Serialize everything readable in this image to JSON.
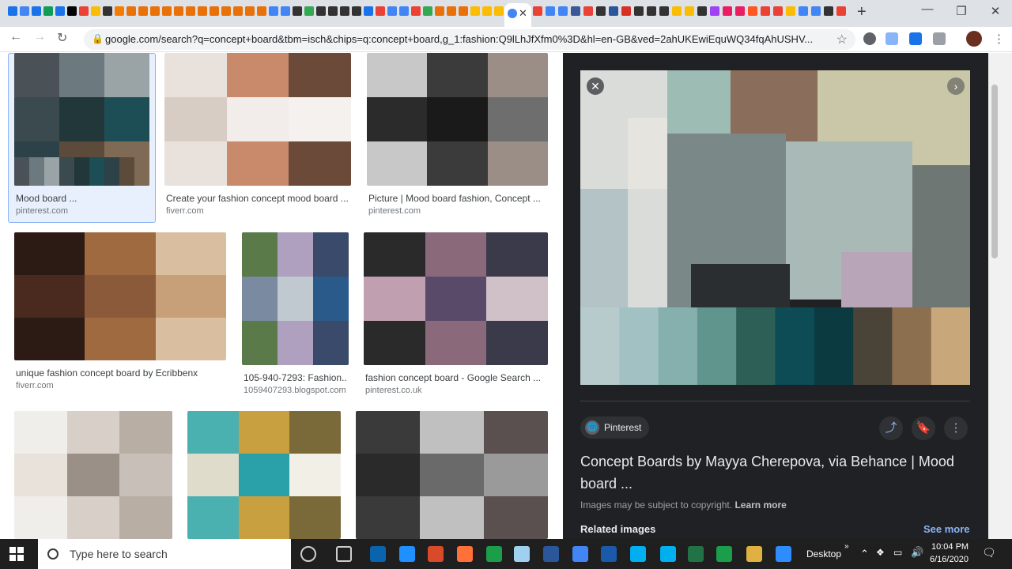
{
  "browser": {
    "tab_favicons": [
      "#1a73e8",
      "#4285f4",
      "#1a73e8",
      "#0f9d58",
      "#1a73e8",
      "#000000",
      "#ea4335",
      "#fbbc05",
      "#333333",
      "#f57c00",
      "#e8710a",
      "#e8710a",
      "#e8710a",
      "#e8710a",
      "#e8710a",
      "#e8710a",
      "#e8710a",
      "#e8710a",
      "#e8710a",
      "#e8710a",
      "#e8710a",
      "#e8710a",
      "#4285f4",
      "#4285f4",
      "#333333",
      "#34a853",
      "#333333",
      "#333333",
      "#333333",
      "#333333",
      "#1a73e8",
      "#ea4335",
      "#4285f4",
      "#4285f4",
      "#ea4335",
      "#34a853",
      "#e8710a",
      "#e8710a",
      "#e8710a",
      "#fbbc05",
      "#fbbc05",
      "#fbbc05"
    ],
    "tab_favicons_right": [
      "#ea4335",
      "#4285f4",
      "#4285f4",
      "#3b5998",
      "#ea4335",
      "#333333",
      "#2b579a",
      "#d93025",
      "#333333",
      "#333333",
      "#333333",
      "#fbbc05",
      "#fbbc05",
      "#333333",
      "#a142f4",
      "#e91e63",
      "#e91e63",
      "#ff5722",
      "#ea4335",
      "#ea4335",
      "#fbbc05",
      "#4285f4",
      "#4285f4",
      "#333333",
      "#ea4335"
    ],
    "active_tab_close": "✕",
    "new_tab": "+",
    "minimize": "—",
    "maximize": "❐",
    "close": "✕",
    "back": "←",
    "forward": "→",
    "reload": "↻",
    "url": "google.com/search?q=concept+board&tbm=isch&chips=q:concept+board,g_1:fashion:Q9lLhJfXfm0%3D&hl=en-GB&ved=2ahUKEwiEquWQ34fqAhUSHV...",
    "bookmark_star": "☆",
    "menu": "⋮"
  },
  "results": [
    {
      "title": "Mood board ...",
      "source": "pinterest.com",
      "selected": true,
      "palette": [
        "#4b5257",
        "#6c7a80",
        "#9aa4a6",
        "#3a4a4e",
        "#22373a",
        "#1d4e55",
        "#2d4148",
        "#5c4a3b",
        "#7e6a55"
      ]
    },
    {
      "title": "Create your fashion concept mood board ...",
      "source": "fiverr.com",
      "selected": false,
      "palette": [
        "#f4f1ee",
        "#e9e2dc",
        "#c98a6c",
        "#6b4a3a",
        "#d7cdc5",
        "#f2ecea"
      ]
    },
    {
      "title": "Picture | Mood board fashion, Concept ...",
      "source": "pinterest.com",
      "selected": false,
      "palette": [
        "#1a1a1a",
        "#6e6e6e",
        "#c8c8c8",
        "#3b3b3b",
        "#9a8e86",
        "#2b2b2b"
      ]
    },
    {
      "title": "unique fashion concept board by Ecribbenx",
      "source": "fiverr.com",
      "selected": false,
      "palette": [
        "#4a2a1e",
        "#8a5a3a",
        "#c7a07a",
        "#2c1a14",
        "#a06a40",
        "#d9bfa0"
      ]
    },
    {
      "title": "105-940-7293: Fashion...",
      "source": "1059407293.blogspot.com",
      "selected": false,
      "palette": [
        "#3a4a6a",
        "#7a8aa0",
        "#c0c8d0",
        "#2a5a8a",
        "#5a7a4a",
        "#b0a0c0"
      ]
    },
    {
      "title": "fashion concept board - Google Search ...",
      "source": "pinterest.co.uk",
      "selected": false,
      "palette": [
        "#8a6a7a",
        "#3a3a4a",
        "#c0a0b0",
        "#5a4a6a",
        "#d0c0c8",
        "#2a2a2a"
      ]
    },
    {
      "title": "",
      "source": "",
      "selected": false,
      "palette": [
        "#f0eeea",
        "#d8d0c8",
        "#b8aea4",
        "#e8e2da",
        "#9a9088",
        "#c8c0b8"
      ]
    },
    {
      "title": "",
      "source": "",
      "selected": false,
      "palette": [
        "#f2efe6",
        "#4ab0b0",
        "#c8a040",
        "#7a6a3a",
        "#e0dccc",
        "#2aa0a8"
      ]
    },
    {
      "title": "",
      "source": "",
      "selected": false,
      "palette": [
        "#6a6a6a",
        "#9a9a9a",
        "#3a3a3a",
        "#c0c0c0",
        "#5a5050",
        "#2a2a2a"
      ]
    }
  ],
  "panel": {
    "close": "✕",
    "next": "›",
    "source": "Pinterest",
    "source_icon": "🌐",
    "title": "Concept Boards by Mayya Cherepova, via Behance | Mood board ...",
    "copyright": "Images may be subject to copyright.",
    "learn_more": "Learn more",
    "related": "Related images",
    "see_more": "See more",
    "share_icon": "⤴",
    "save_icon": "🔖",
    "more_icon": "⋮",
    "swatches": [
      "#b7cbcc",
      "#a2c1c2",
      "#86b0ad",
      "#5f958c",
      "#2d5f57",
      "#0d4b55",
      "#0b3a40",
      "#4a4438",
      "#8c6f4f",
      "#c8a77a"
    ]
  },
  "taskbar": {
    "search_placeholder": "Type here to search",
    "desktop": "Desktop",
    "time": "10:04 PM",
    "date": "6/16/2020",
    "icons": [
      "#cfcfcf",
      "#cfcfcf",
      "#0a64ad",
      "#1e90ff",
      "#d84a2a",
      "#ff7139",
      "#1a9e4a",
      "#a0d0f0",
      "#2b579a",
      "#4285f4",
      "#1a5aa8",
      "#00aff0",
      "#00aff0",
      "#217346",
      "#1a9e4a",
      "#e0b040",
      "#2d8cff"
    ]
  }
}
